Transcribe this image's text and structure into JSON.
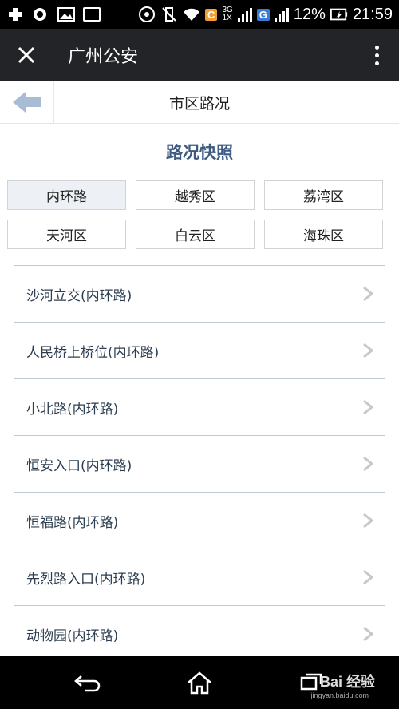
{
  "status_bar": {
    "network_3g": "3G",
    "network_1x": "1X",
    "c_badge": "C",
    "g_badge": "G",
    "battery": "12%",
    "time": "21:59"
  },
  "title_bar": {
    "title": "广州公安"
  },
  "page_header": {
    "title": "市区路况"
  },
  "section": {
    "title": "路况快照"
  },
  "districts": [
    {
      "label": "内环路",
      "active": true
    },
    {
      "label": "越秀区"
    },
    {
      "label": "荔湾区"
    },
    {
      "label": "天河区"
    },
    {
      "label": "白云区"
    },
    {
      "label": "海珠区"
    }
  ],
  "routes": [
    {
      "label": "沙河立交(内环路)"
    },
    {
      "label": "人民桥上桥位(内环路)"
    },
    {
      "label": "小北路(内环路)"
    },
    {
      "label": "恒安入口(内环路)"
    },
    {
      "label": "恒福路(内环路)"
    },
    {
      "label": "先烈路入口(内环路)"
    },
    {
      "label": "动物园(内环路)"
    }
  ],
  "watermark": {
    "text": "Bai 经验",
    "sub": "jingyan.baidu.com"
  },
  "colors": {
    "accent": "#3c5a82",
    "title_bar": "#222427",
    "active_tab": "#edf1f5"
  }
}
